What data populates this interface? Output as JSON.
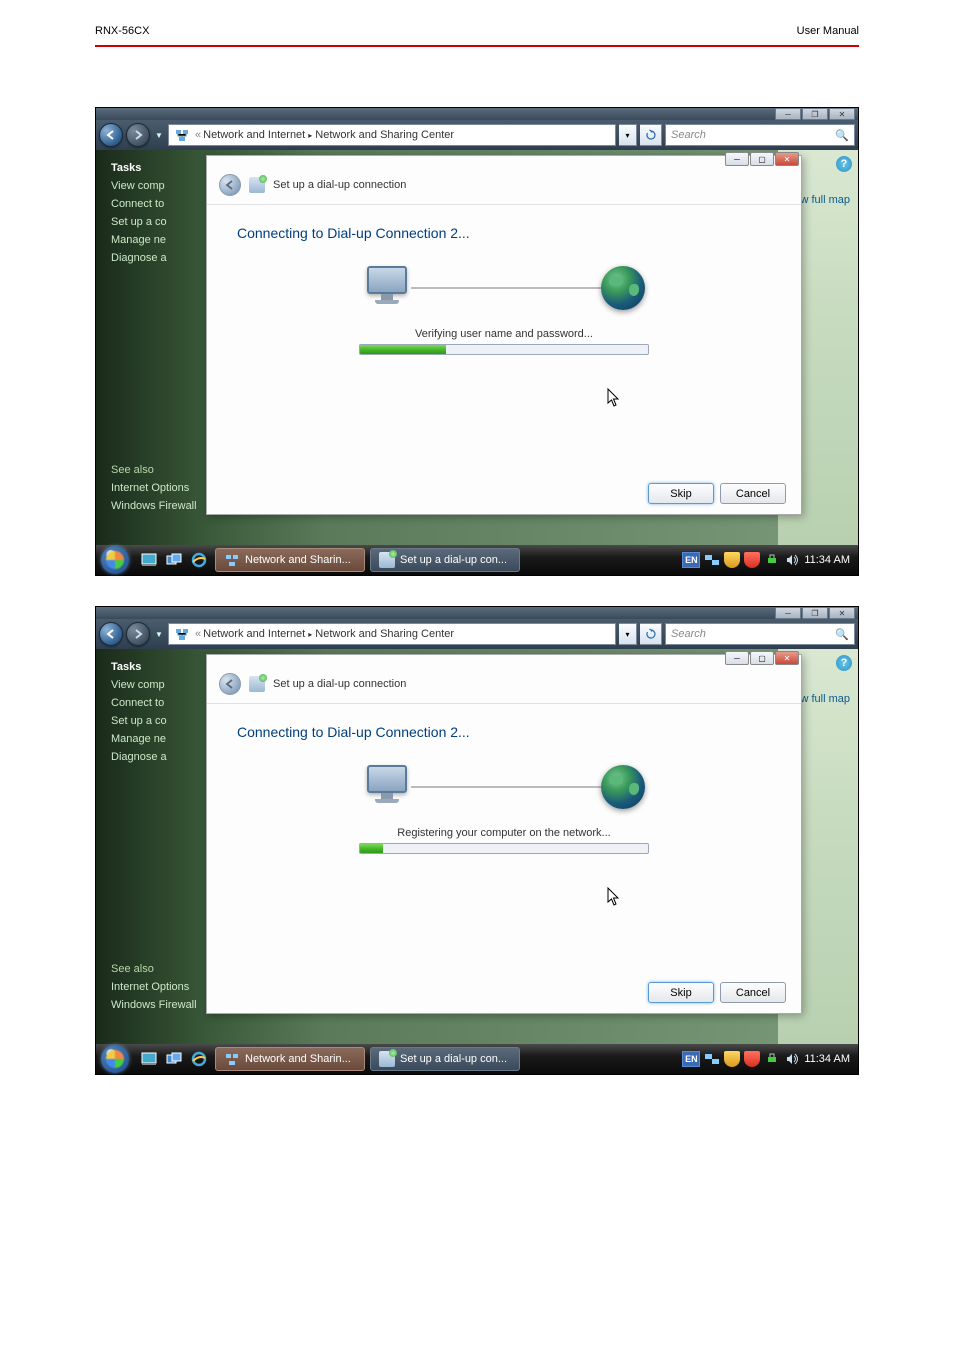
{
  "header": {
    "product": "RNX-56CX",
    "doc": "User  Manual"
  },
  "explorer": {
    "breadcrumb": {
      "prefix": "«",
      "part1": "Network and Internet",
      "part2": "Network and Sharing Center"
    },
    "search_placeholder": "Search",
    "full_map": "iew full map",
    "sidebar": {
      "title": "Tasks",
      "links": [
        "View comp",
        "Connect to",
        "Set up a co",
        "Manage ne",
        "Diagnose a"
      ],
      "see_also_title": "See also",
      "see_also": [
        "Internet Options",
        "Windows Firewall"
      ]
    }
  },
  "dialog": {
    "title": "Set up a dial-up connection",
    "heading": "Connecting to Dial-up Connection 2...",
    "skip": "Skip",
    "cancel": "Cancel"
  },
  "shot1": {
    "status": "Verifying user name and password...",
    "progress_pct": 30
  },
  "shot2": {
    "status": "Registering your computer on the network...",
    "progress_pct": 8
  },
  "taskbar": {
    "btn1": "Network and Sharin...",
    "btn2": "Set up a dial-up con...",
    "lang": "EN",
    "time": "11:34 AM"
  }
}
